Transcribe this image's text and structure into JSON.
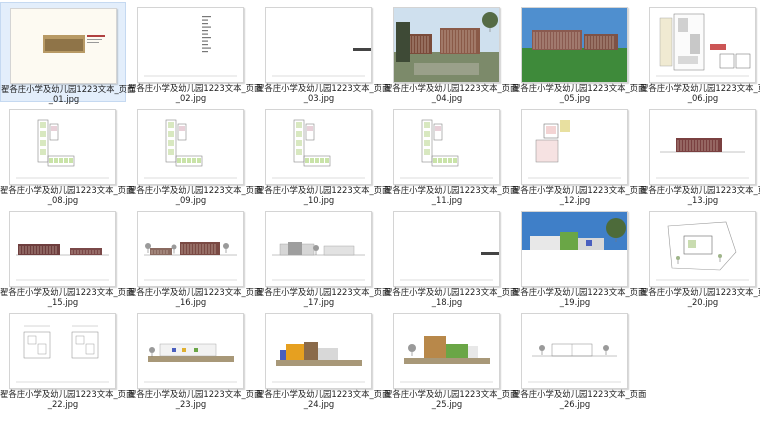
{
  "files": [
    {
      "line1": "翟各庄小学及幼儿园1223文本_页面",
      "line2": "_01.jpg",
      "selected": true,
      "preview": "cover"
    },
    {
      "line1": "翟各庄小学及幼儿园1223文本_页面",
      "line2": "_02.jpg",
      "preview": "toc"
    },
    {
      "line1": "翟各庄小学及幼儿园1223文本_页面",
      "line2": "_03.jpg",
      "preview": "section"
    },
    {
      "line1": "翟各庄小学及幼儿园1223文本_页面",
      "line2": "_04.jpg",
      "preview": "photo-school"
    },
    {
      "line1": "翟各庄小学及幼儿园1223文本_页面",
      "line2": "_05.jpg",
      "preview": "photo-lawn"
    },
    {
      "line1": "翟各庄小学及幼儿园1223文本_页面",
      "line2": "_06.jpg",
      "preview": "siteplan-color"
    },
    {
      "line1": "翟各庄小学及幼儿园1223文本_页面",
      "line2": "_08.jpg",
      "preview": "floorplan"
    },
    {
      "line1": "翟各庄小学及幼儿园1223文本_页面",
      "line2": "_09.jpg",
      "preview": "floorplan"
    },
    {
      "line1": "翟各庄小学及幼儿园1223文本_页面",
      "line2": "_10.jpg",
      "preview": "floorplan"
    },
    {
      "line1": "翟各庄小学及幼儿园1223文本_页面",
      "line2": "_11.jpg",
      "preview": "floorplan"
    },
    {
      "line1": "翟各庄小学及幼儿园1223文本_页面",
      "line2": "_12.jpg",
      "preview": "colorplan"
    },
    {
      "line1": "翟各庄小学及幼儿园1223文本_页面",
      "line2": "_13.jpg",
      "preview": "elevation-single"
    },
    {
      "line1": "翟各庄小学及幼儿园1223文本_页面",
      "line2": "_15.jpg",
      "preview": "elevation-double"
    },
    {
      "line1": "翟各庄小学及幼儿园1223文本_页面",
      "line2": "_16.jpg",
      "preview": "elevation-trees"
    },
    {
      "line1": "翟各庄小学及幼儿园1223文本_页面",
      "line2": "_17.jpg",
      "preview": "elevation-gray"
    },
    {
      "line1": "翟各庄小学及幼儿园1223文本_页面",
      "line2": "_18.jpg",
      "preview": "section"
    },
    {
      "line1": "翟各庄小学及幼儿园1223文本_页面",
      "line2": "_19.jpg",
      "preview": "photo-kinder"
    },
    {
      "line1": "翟各庄小学及幼儿园1223文本_页面",
      "line2": "_20.jpg",
      "preview": "siteplan-line"
    },
    {
      "line1": "翟各庄小学及幼儿园1223文本_页面",
      "line2": "_22.jpg",
      "preview": "twin-plans"
    },
    {
      "line1": "翟各庄小学及幼儿园1223文本_页面",
      "line2": "_23.jpg",
      "preview": "kinder-elev-a"
    },
    {
      "line1": "翟各庄小学及幼儿园1223文本_页面",
      "line2": "_24.jpg",
      "preview": "kinder-elev-b"
    },
    {
      "line1": "翟各庄小学及幼儿园1223文本_页面",
      "line2": "_25.jpg",
      "preview": "kinder-elev-c"
    },
    {
      "line1": "翟各庄小学及幼儿园1223文本_页面",
      "line2": "_26.jpg",
      "preview": "kinder-section"
    }
  ]
}
